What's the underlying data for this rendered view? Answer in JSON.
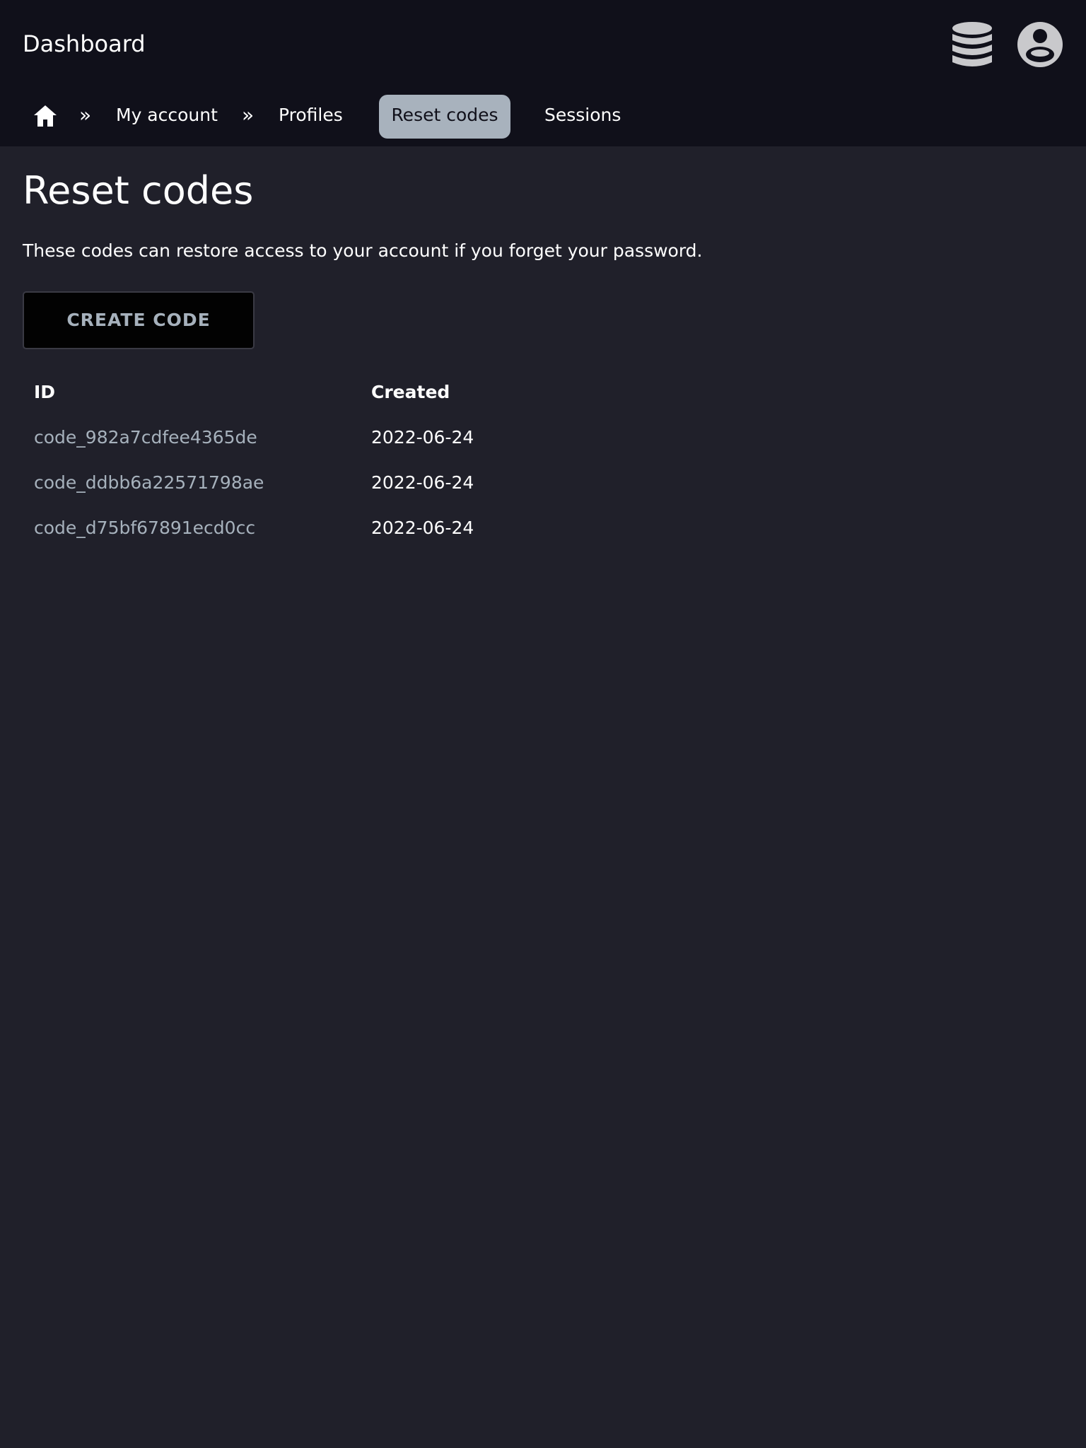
{
  "header": {
    "title": "Dashboard",
    "icons": [
      "database-icon",
      "account-circle-icon"
    ]
  },
  "breadcrumb": {
    "home_icon": "home-icon",
    "separator": "»",
    "items": [
      "My account",
      "Profiles"
    ]
  },
  "tabs": [
    {
      "label": "Reset codes",
      "active": true
    },
    {
      "label": "Sessions",
      "active": false
    }
  ],
  "page": {
    "title": "Reset codes",
    "description": "These codes can restore access to your account if you forget your password.",
    "create_button_label": "CREATE CODE"
  },
  "table": {
    "headers": [
      "ID",
      "Created"
    ],
    "rows": [
      {
        "id": "code_982a7cdfee4365de",
        "created": "2022-06-24"
      },
      {
        "id": "code_ddbb6a22571798ae",
        "created": "2022-06-24"
      },
      {
        "id": "code_d75bf67891ecd0cc",
        "created": "2022-06-24"
      }
    ]
  },
  "colors": {
    "background": "#20202a",
    "header_background": "#10101a",
    "active_tab": "#a8b2bd",
    "muted_text": "#a6b1bc"
  }
}
